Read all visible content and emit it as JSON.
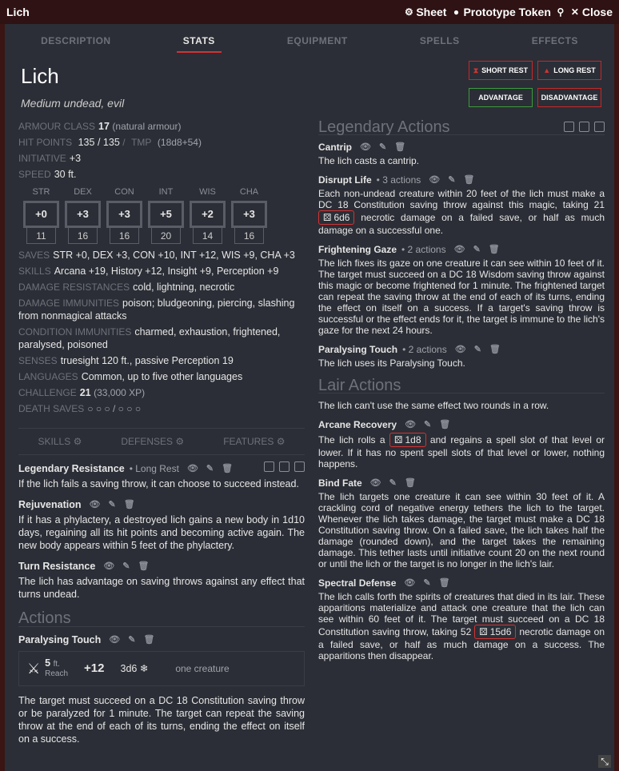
{
  "window": {
    "title": "Lich",
    "actions": [
      {
        "label": "Sheet"
      },
      {
        "label": "Prototype Token"
      },
      {
        "label": ""
      },
      {
        "label": "Close"
      }
    ]
  },
  "tabs": [
    "DESCRIPTION",
    "STATS",
    "EQUIPMENT",
    "SPELLS",
    "EFFECTS"
  ],
  "header": {
    "name": "Lich",
    "subtitle": "Medium undead, evil"
  },
  "rest": {
    "short": "SHORT REST",
    "long": "LONG REST",
    "adv": "ADVANTAGE",
    "disadv": "DISADVANTAGE"
  },
  "stats": {
    "ac_label": "ARMOUR CLASS",
    "ac": "17",
    "ac_note": "(natural armour)",
    "hp_label": "HIT POINTS",
    "hp": "135",
    "hp_sep": "/",
    "hp_max": "135",
    "hp_sep2": "/",
    "tmp_label": "TMP",
    "hd": "(18d8+54)",
    "init_label": "INITIATIVE",
    "init": "+3",
    "speed_label": "SPEED",
    "speed": "30 ft."
  },
  "abilities": [
    {
      "n": "STR",
      "mod": "+0",
      "score": "11"
    },
    {
      "n": "DEX",
      "mod": "+3",
      "score": "16"
    },
    {
      "n": "CON",
      "mod": "+3",
      "score": "16"
    },
    {
      "n": "INT",
      "mod": "+5",
      "score": "20"
    },
    {
      "n": "WIS",
      "mod": "+2",
      "score": "14"
    },
    {
      "n": "CHA",
      "mod": "+3",
      "score": "16"
    }
  ],
  "props": [
    {
      "label": "SAVES",
      "val": "STR +0, DEX +3, CON +10, INT +12, WIS +9, CHA +3"
    },
    {
      "label": "SKILLS",
      "val": "Arcana +19, History +12, Insight +9, Perception +9"
    },
    {
      "label": "DAMAGE RESISTANCES",
      "val": "cold, lightning, necrotic"
    },
    {
      "label": "DAMAGE IMMUNITIES",
      "val": "poison; bludgeoning, piercing, slashing from nonmagical attacks"
    },
    {
      "label": "CONDITION IMMUNITIES",
      "val": "charmed, exhaustion, frightened, paralysed, poisoned"
    },
    {
      "label": "SENSES",
      "val": "truesight 120 ft., passive Perception 19"
    },
    {
      "label": "LANGUAGES",
      "val": "Common, up to five other languages"
    },
    {
      "label": "CHALLENGE",
      "val": "21",
      "extra": "(33,000 XP)"
    },
    {
      "label": "DEATH SAVES",
      "val": "○ ○ ○  /  ○ ○ ○"
    }
  ],
  "subtabs": [
    "SKILLS",
    "DEFENSES",
    "FEATURES"
  ],
  "features": [
    {
      "name": "Legendary Resistance",
      "meta": "• Long Rest",
      "desc": "If the lich fails a saving throw, it can choose to succeed instead."
    },
    {
      "name": "Rejuvenation",
      "meta": "",
      "desc": "If it has a phylactery, a destroyed lich gains a new body in 1d10 days, regaining all its hit points and becoming active again. The new body appears within 5 feet of the phylactery."
    },
    {
      "name": "Turn Resistance",
      "meta": "",
      "desc": "The lich has advantage on saving throws against any effect that turns undead."
    }
  ],
  "actions": {
    "title": "Actions",
    "name": "Paralysing Touch",
    "range": "5",
    "range_unit": "ft.",
    "range_label": "Reach",
    "tohit": "+12",
    "dmg": "3d6",
    "target": "one creature",
    "desc": "The target must succeed on a DC 18 Constitution saving throw or be paralyzed for 1 minute. The target can repeat the saving throw at the end of each of its turns, ending the effect on itself on a success."
  },
  "legendary": {
    "title": "Legendary Actions",
    "items": [
      {
        "name": "Cantrip",
        "meta": "",
        "desc": "The lich casts a cantrip."
      },
      {
        "name": "Disrupt Life",
        "meta": "• 3 actions",
        "desc1": "Each non-undead creature within 20 feet of the lich must make a DC 18 Constitution saving throw against this magic, taking 21",
        "dice": "6d6",
        "desc2": "necrotic damage on a failed save, or half as much damage on a successful one."
      },
      {
        "name": "Frightening Gaze",
        "meta": "• 2 actions",
        "desc": "The lich fixes its gaze on one creature it can see within 10 feet of it. The target must succeed on a DC 18 Wisdom saving throw against this magic or become frightened for 1 minute. The frightened target can repeat the saving throw at the end of each of its turns, ending the effect on itself on a success. If a target's saving throw is successful or the effect ends for it, the target is immune to the lich's gaze for the next 24 hours."
      },
      {
        "name": "Paralysing Touch",
        "meta": "• 2 actions",
        "desc": "The lich uses its Paralysing Touch."
      }
    ]
  },
  "lair": {
    "title": "Lair Actions",
    "note": "The lich can't use the same effect two rounds in a row.",
    "items": [
      {
        "name": "Arcane Recovery",
        "desc1": "The lich rolls a",
        "dice": "1d8",
        "desc2": "and regains a spell slot of that level or lower. If it has no spent spell slots of that level or lower, nothing happens."
      },
      {
        "name": "Bind Fate",
        "desc": "The lich targets one creature it can see within 30 feet of it. A crackling cord of negative energy tethers the lich to the target. Whenever the lich takes damage, the target must make a DC 18 Constitution saving throw. On a failed save, the lich takes half the damage (rounded down), and the target takes the remaining damage. This tether lasts until initiative count 20 on the next round or until the lich or the target is no longer in the lich's lair."
      },
      {
        "name": "Spectral Defense",
        "desc1": "The lich calls forth the spirits of creatures that died in its lair. These apparitions materialize and attack one creature that the lich can see within 60 feet of it. The target must succeed on a DC 18 Constitution saving throw, taking 52",
        "dice": "15d6",
        "desc2": "necrotic damage on a failed save, or half as much damage on a success. The apparitions then disappear."
      }
    ]
  }
}
